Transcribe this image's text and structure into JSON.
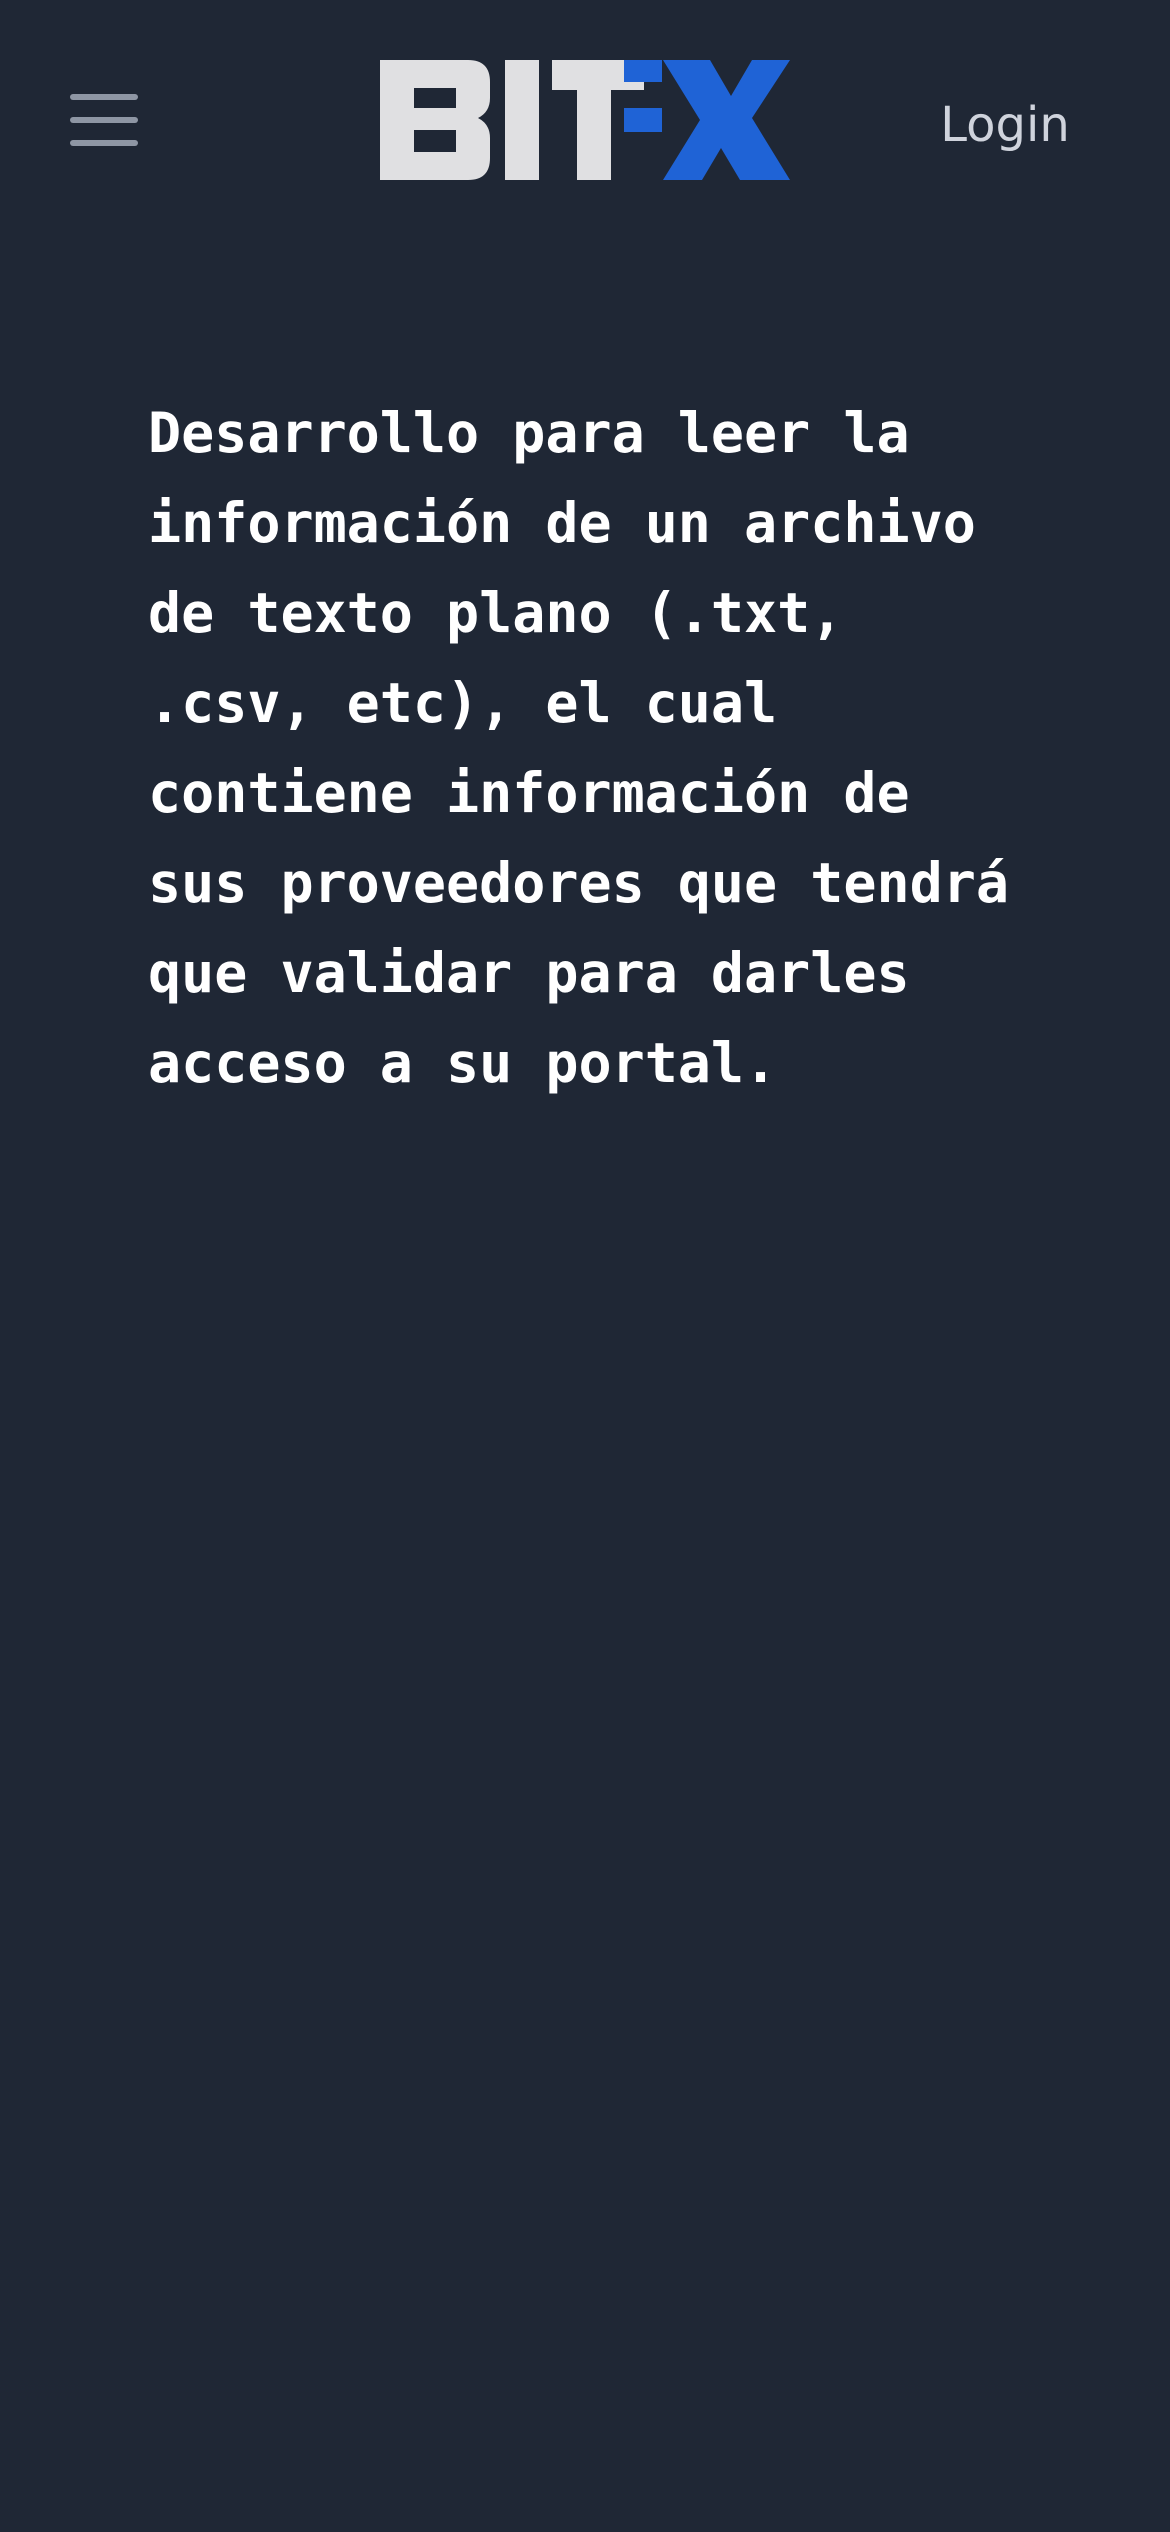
{
  "header": {
    "menu_icon": "hamburger-menu-icon",
    "logo_text": "BITFX",
    "login_label": "Login"
  },
  "main": {
    "description": "Desarrollo para leer la\ninformación de un archivo\nde texto plano (.txt,\n.csv, etc), el cual\ncontiene información de\nsus proveedores que tendrá\nque validar para darles\nacceso a su portal."
  },
  "colors": {
    "background": "#1f2735",
    "logo_gray": "#e0e0e2",
    "logo_blue": "#1f63d6",
    "menu_icon": "#8e96a4",
    "login_text": "#cfd3dc",
    "body_text": "#ffffff"
  }
}
